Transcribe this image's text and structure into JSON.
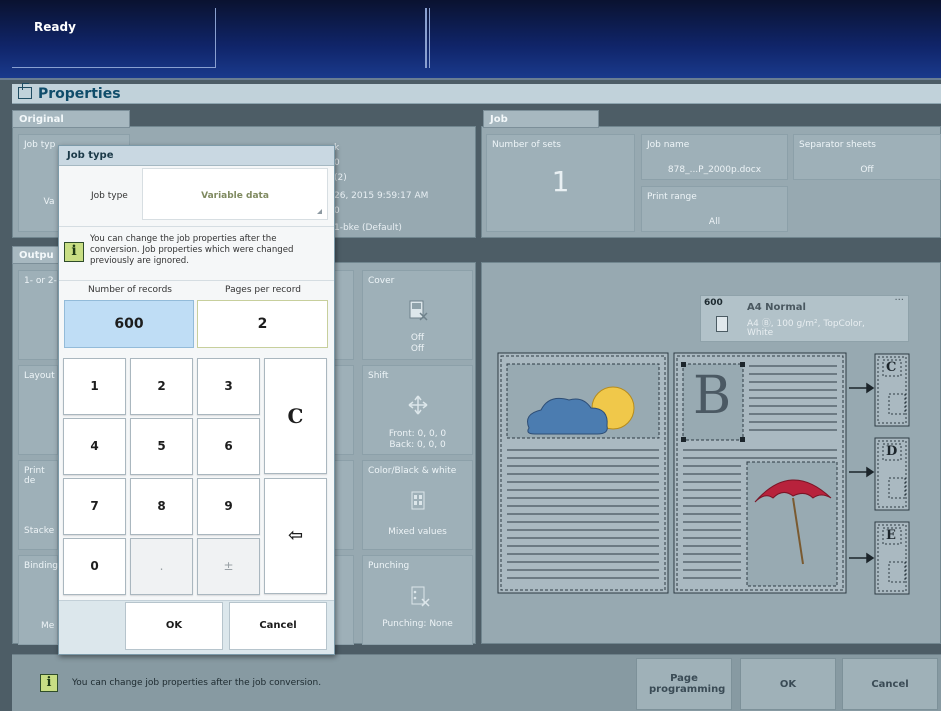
{
  "status": {
    "text": "Ready"
  },
  "properties": {
    "title": "Properties"
  },
  "original": {
    "tab": "Original",
    "job_type_label_partial": "Job typ",
    "value_partial": "Va",
    "right_col": [
      "k",
      "0",
      "(2)",
      "26, 2015 9:59:17 AM",
      "0",
      "1-bke (Default)"
    ]
  },
  "job": {
    "tab": "Job",
    "number_of_sets": {
      "label": "Number of sets",
      "value": "1"
    },
    "job_name": {
      "label": "Job name",
      "value": "878_...P_2000p.docx"
    },
    "separator_sheets": {
      "label": "Separator sheets",
      "value": "Off"
    },
    "print_range": {
      "label": "Print range",
      "value": "All"
    }
  },
  "output": {
    "tab_partial": "Outpu",
    "left_labels": [
      "1- or 2-",
      "Layout",
      "Print de",
      "Stacke",
      "Binding",
      "Me"
    ],
    "cover": {
      "label": "Cover",
      "value1": "Off",
      "value2": "Off"
    },
    "shift": {
      "label": "Shift",
      "front": "Front: 0, 0, 0",
      "back": "Back: 0, 0, 0"
    },
    "color": {
      "label": "Color/Black & white",
      "value": "Mixed values"
    },
    "punching": {
      "label": "Punching",
      "value": "Punching: None"
    }
  },
  "paper": {
    "count": "600",
    "name": "A4 Normal",
    "detail1": "A4 Ⓑ, 100 g/m², TopColor,",
    "detail2": "White",
    "more": "..."
  },
  "diagram": {
    "big_letter": "B",
    "small_letters": [
      "C",
      "D",
      "E"
    ]
  },
  "dialog": {
    "title": "Job type",
    "job_type_label": "Job type",
    "job_type_value": "Variable data",
    "info_text": "You can change the job properties after the conversion. Job properties which were changed previously are ignored.",
    "records_label": "Number of records",
    "records_value": "600",
    "pages_label": "Pages per record",
    "pages_value": "2",
    "keys": [
      "1",
      "2",
      "3",
      "4",
      "5",
      "6",
      "7",
      "8",
      "9",
      "0",
      ".",
      "±"
    ],
    "clear_key": "C",
    "back_key": "⇦",
    "ok": "OK",
    "cancel": "Cancel"
  },
  "footer": {
    "info": "You can change job properties after the job conversion.",
    "page_programming": "Page programming",
    "ok": "OK",
    "cancel": "Cancel"
  },
  "colors": {
    "accent_blue": "#bfddf5",
    "header_bg": "#10256a",
    "info_green": "#c8de84"
  }
}
